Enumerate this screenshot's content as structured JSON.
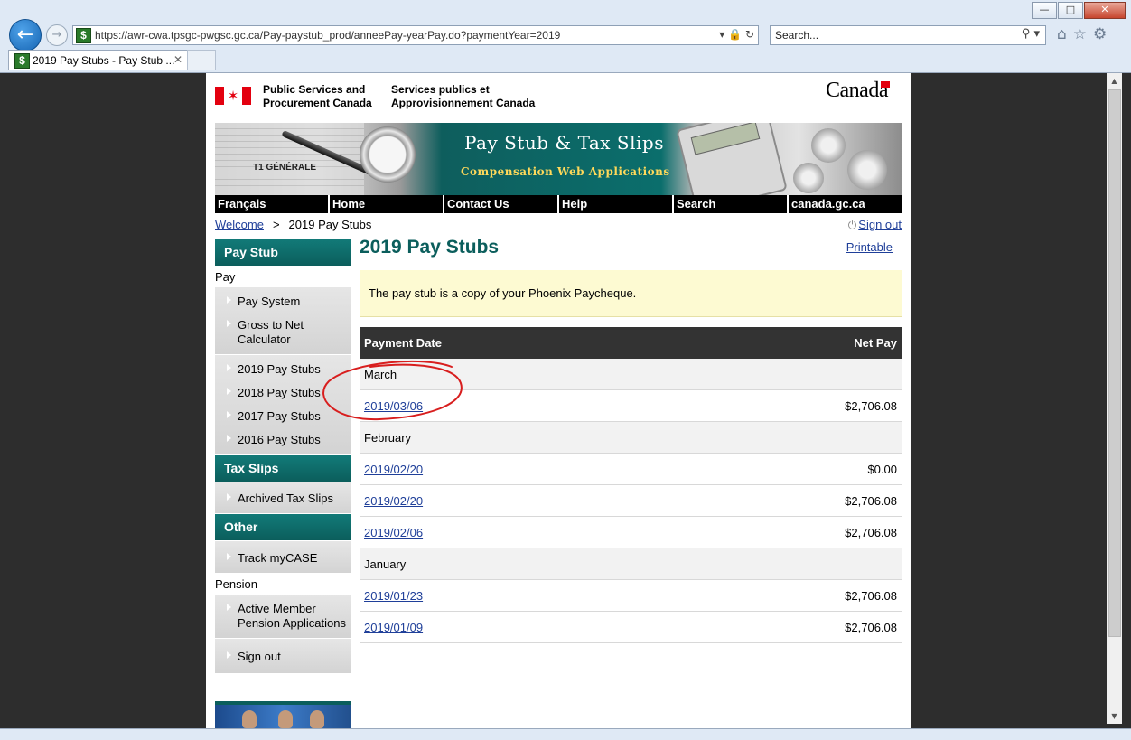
{
  "browser": {
    "url": "https://awr-cwa.tpsgc-pwgsc.gc.ca/Pay-paystub_prod/anneePay-yearPay.do?paymentYear=2019",
    "search_placeholder": "Search...",
    "tab_title": "2019 Pay Stubs - Pay Stub ...",
    "window_controls": [
      "minimize",
      "maximize",
      "close"
    ],
    "toolbar_icons": [
      "home-icon",
      "star-icon",
      "gear-icon"
    ]
  },
  "header": {
    "org_en": "Public Services and Procurement Canada",
    "org_fr": "Services publics et Approvisionnement Canada",
    "wordmark": "Canada"
  },
  "banner": {
    "title": "Pay Stub & Tax Slips",
    "subtitle": "Compensation Web Applications",
    "image_text": "T1 GÉNÉRALE"
  },
  "topnav": [
    "Français",
    "Home",
    "Contact Us",
    "Help",
    "Search",
    "canada.gc.ca"
  ],
  "breadcrumb": {
    "home": "Welcome",
    "separator": ">",
    "current": "2019 Pay Stubs"
  },
  "signout": "Sign out",
  "leftnav": {
    "pay_stub_heading": "Pay Stub",
    "pay_label": "Pay",
    "pay_links": [
      "Pay System",
      "Gross to Net Calculator"
    ],
    "stub_links": [
      "2019 Pay Stubs",
      "2018 Pay Stubs",
      "2017 Pay Stubs",
      "2016 Pay Stubs"
    ],
    "tax_heading": "Tax Slips",
    "tax_links": [
      "Archived Tax Slips"
    ],
    "other_heading": "Other",
    "other_links": [
      "Track myCASE"
    ],
    "pension_label": "Pension",
    "pension_links": [
      "Active Member Pension Applications"
    ],
    "signout_link": "Sign out"
  },
  "main": {
    "title": "2019 Pay Stubs",
    "printable": "Printable",
    "notice": "The pay stub is a copy of your Phoenix Paycheque.",
    "table": {
      "col_date": "Payment Date",
      "col_net": "Net Pay",
      "groups": [
        {
          "month": "March",
          "rows": [
            {
              "date": "2019/03/06",
              "net": "$2,706.08"
            }
          ]
        },
        {
          "month": "February",
          "rows": [
            {
              "date": "2019/02/20",
              "net": "$0.00"
            },
            {
              "date": "2019/02/20",
              "net": "$2,706.08"
            },
            {
              "date": "2019/02/06",
              "net": "$2,706.08"
            }
          ]
        },
        {
          "month": "January",
          "rows": [
            {
              "date": "2019/01/23",
              "net": "$2,706.08"
            },
            {
              "date": "2019/01/09",
              "net": "$2,706.08"
            }
          ]
        }
      ]
    }
  },
  "colors": {
    "teal": "#0b5e5c",
    "link": "#1f3f99",
    "notice_bg": "#fdfad2",
    "annotation": "#d81e1e"
  }
}
